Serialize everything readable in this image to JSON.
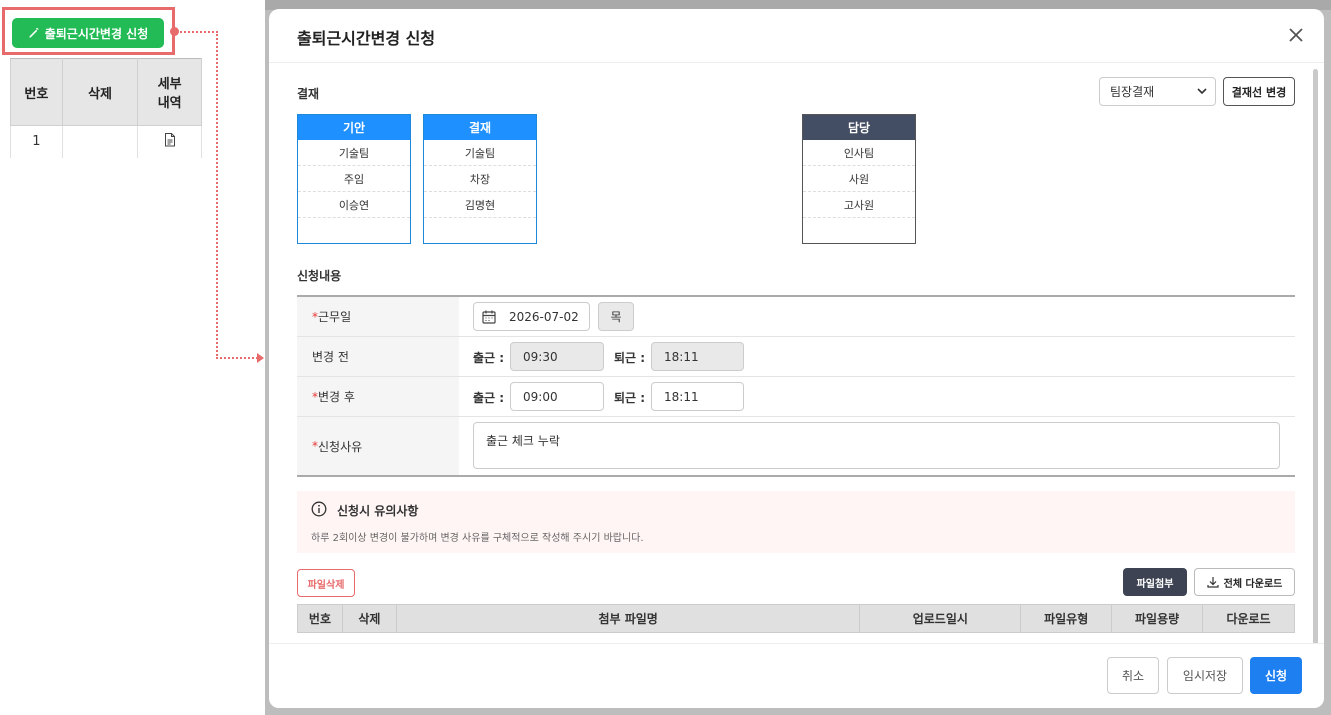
{
  "launcher": {
    "button_label": "출퇴근시간변경 신청",
    "table": {
      "headers": [
        "번호",
        "삭제",
        "세부\n내역"
      ],
      "header_no": "번호",
      "header_delete": "삭제",
      "header_detail_1": "세부",
      "header_detail_2": "내역",
      "rows": [
        {
          "no": "1"
        }
      ]
    }
  },
  "modal": {
    "title": "출퇴근시간변경 신청",
    "approval": {
      "section_label": "결재",
      "selected_line": "팀장결재",
      "change_button": "결재선 변경",
      "boxes": [
        {
          "head": "기안",
          "dept": "기술팀",
          "rank": "주임",
          "name": "이승연"
        },
        {
          "head": "결재",
          "dept": "기술팀",
          "rank": "차장",
          "name": "김명현"
        },
        {
          "head": "담당",
          "dept": "인사팀",
          "rank": "사원",
          "name": "고사원"
        }
      ]
    },
    "content": {
      "section_label": "신청내용",
      "work_date_label": "근무일",
      "work_date": "2026-07-02",
      "weekday": "목",
      "before_label": "변경 전",
      "after_label": "변경 후",
      "in_label": "출근 :",
      "out_label": "퇴근 :",
      "before_in": "09:30",
      "before_out": "18:11",
      "after_in": "09:00",
      "after_out": "18:11",
      "reason_label": "신청사유",
      "reason": "출근 체크 누락",
      "required_mark": "*"
    },
    "notice": {
      "title": "신청시 유의사항",
      "text": "하루 2회이상 변경이 불가하며 변경 사유를 구체적으로 작성해 주시기 바랍니다."
    },
    "files": {
      "delete_button": "파일삭제",
      "attach_button": "파일첨부",
      "download_all_button": "전체 다운로드",
      "headers": {
        "no": "번호",
        "delete": "삭제",
        "name": "첨부 파일명",
        "uploaded": "업로드일시",
        "type": "파일유형",
        "size": "파일용량",
        "download": "다운로드"
      }
    },
    "footer": {
      "cancel": "취소",
      "temp_save": "임시저장",
      "submit": "신청"
    }
  },
  "colors": {
    "accent_blue": "#1e90ff",
    "submit_blue": "#1e7ff0",
    "launcher_green": "#22bb55",
    "highlight_red": "#e76b6b",
    "dark_head": "#434d63"
  }
}
